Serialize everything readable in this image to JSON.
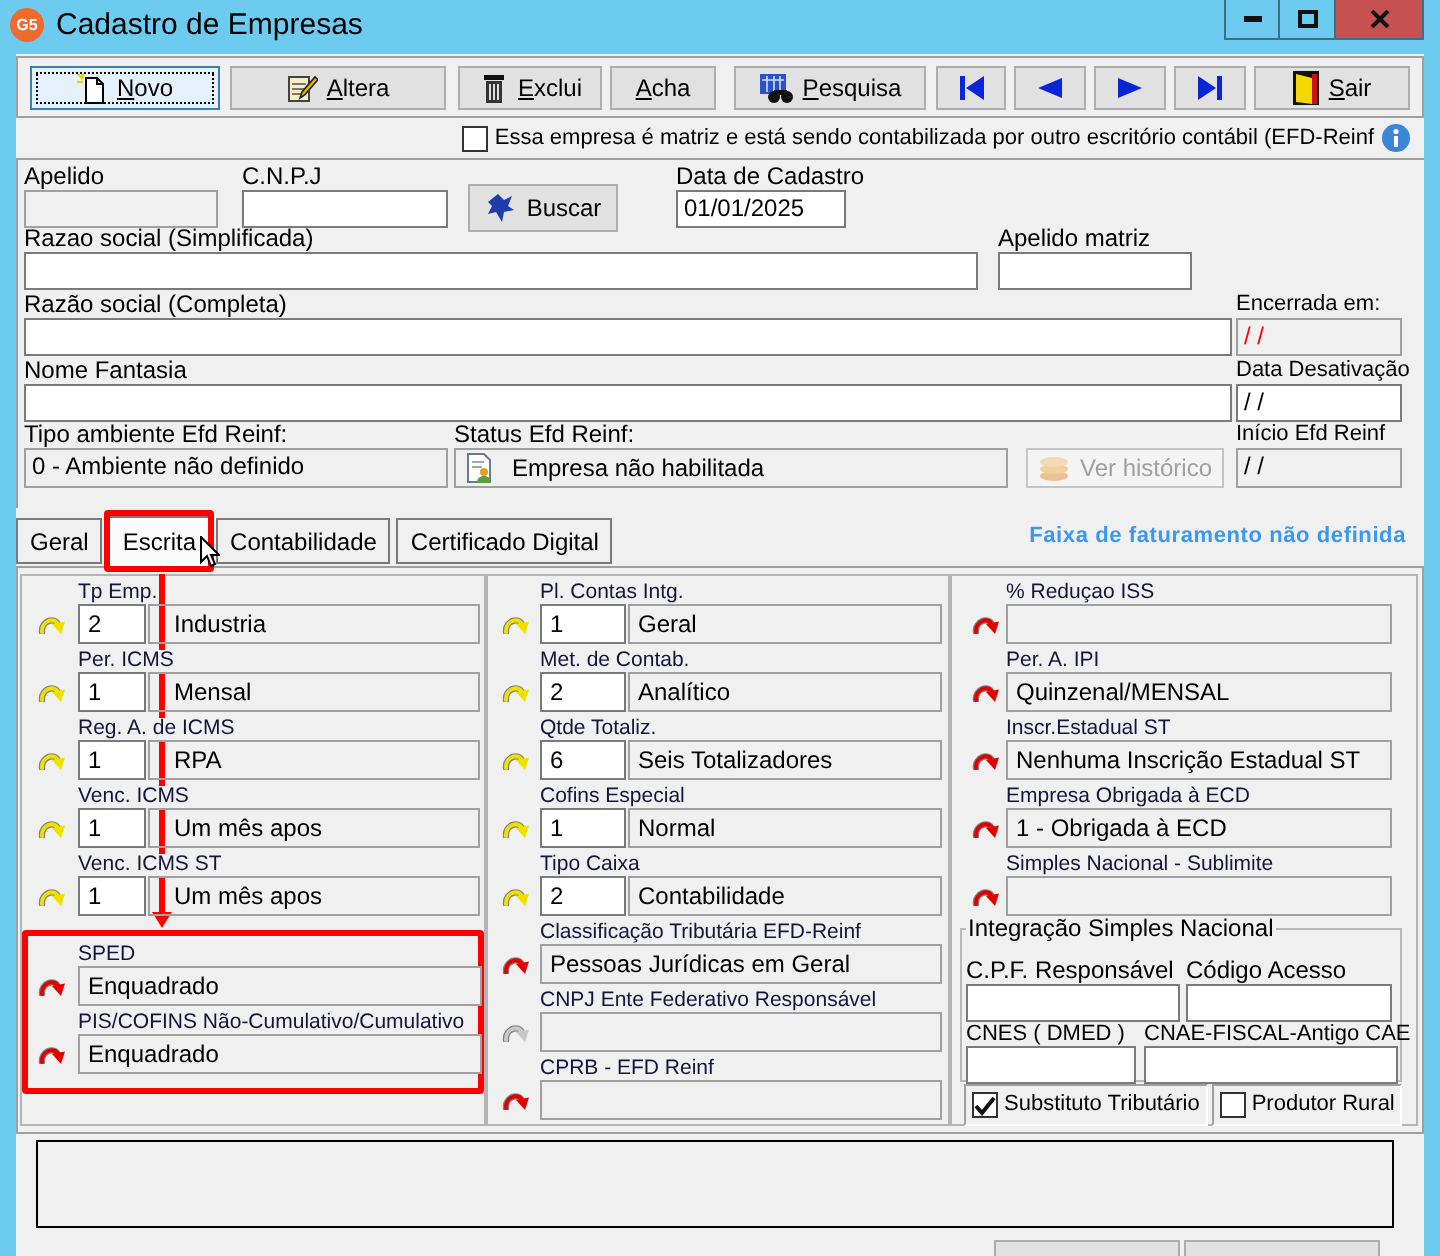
{
  "window": {
    "logo": "G5",
    "title": "Cadastro de Empresas"
  },
  "toolbar": [
    {
      "kind": "new",
      "label": "Novo",
      "mnemonic": true,
      "focused": true
    },
    {
      "kind": "edit",
      "label": "Altera",
      "mnemonic": true,
      "focused": false
    },
    {
      "kind": "delete",
      "label": "Exclui",
      "mnemonic": true,
      "focused": false
    },
    {
      "kind": "find",
      "label": "Acha",
      "mnemonic": true,
      "focused": false
    },
    {
      "kind": "search",
      "label": "Pesquisa",
      "mnemonic": true,
      "focused": false
    },
    {
      "kind": "first",
      "focused": false
    },
    {
      "kind": "prev",
      "focused": false
    },
    {
      "kind": "next",
      "focused": false
    },
    {
      "kind": "last",
      "focused": false
    },
    {
      "kind": "exit",
      "label": "Sair",
      "mnemonic": true,
      "focused": false
    }
  ],
  "matriz_checkbox": {
    "label": "Essa empresa é matriz e está sendo contabilizada por outro escritório contábil (EFD-Reinf",
    "checked": false
  },
  "form": {
    "apelido": {
      "label": "Apelido",
      "disabled": true
    },
    "cnpj": {
      "label": "C.N.P.J",
      "disabled": false
    },
    "buscar_button": {
      "label": "Buscar"
    },
    "data_cadastro": {
      "label": "Data de Cadastro",
      "value": "01/01/2025",
      "disabled": false
    },
    "razao_simplificada": {
      "label": "Razao social (Simplificada)",
      "disabled": false
    },
    "apelido_matriz": {
      "label": "Apelido matriz",
      "disabled": false
    },
    "razao_completa": {
      "label": "Razão social (Completa)",
      "disabled": false
    },
    "encerrada_em": {
      "label": "Encerrada em:",
      "value": "/ /",
      "disabled": true,
      "warning": true
    },
    "nome_fantasia": {
      "label": "Nome Fantasia",
      "disabled": false
    },
    "data_desativacao": {
      "label": "Data Desativação",
      "value": "/ /",
      "disabled": false
    },
    "tipo_ambiente": {
      "label": "Tipo ambiente Efd Reinf:",
      "value": "0 - Ambiente não definido",
      "disabled": true
    },
    "status_efd": {
      "label": "Status Efd Reinf:",
      "value": "Empresa não habilitada",
      "disabled": true
    },
    "ver_historico": {
      "label": "Ver histórico",
      "disabled": true
    },
    "inicio_efd": {
      "label": "Início Efd Reinf",
      "value": "/ /",
      "disabled": true
    }
  },
  "tabs": [
    {
      "label": "Geral",
      "selected": false,
      "highlighted": false
    },
    {
      "label": "Escrita",
      "selected": true,
      "highlighted": true
    },
    {
      "label": "Contabilidade",
      "selected": false,
      "highlighted": false
    },
    {
      "label": "Certificado Digital",
      "selected": false,
      "highlighted": false
    }
  ],
  "notice": "Faixa de faturamento não definida",
  "columns": [
    {
      "fields": [
        {
          "label": "Tp Emp.",
          "code": "2",
          "value": "Industria",
          "color": "#f0e000",
          "highlighted": false
        },
        {
          "label": "Per. ICMS",
          "code": "1",
          "value": "Mensal",
          "color": "#f0e000",
          "highlighted": false
        },
        {
          "label": "Reg. A. de ICMS",
          "code": "1",
          "value": "RPA",
          "color": "#f0e000",
          "highlighted": false
        },
        {
          "label": "Venc. ICMS",
          "code": "1",
          "value": "Um mês apos",
          "color": "#f0e000",
          "highlighted": false
        },
        {
          "label": "Venc. ICMS ST",
          "code": "1",
          "value": "Um mês apos",
          "color": "#f0e000",
          "highlighted": false
        },
        {
          "label": "SPED",
          "value": "Enquadrado",
          "color": "#e00000",
          "highlighted": true
        },
        {
          "label": "PIS/COFINS Não-Cumulativo/Cumulativo",
          "value": "Enquadrado",
          "color": "#e00000",
          "highlighted": true
        }
      ]
    },
    {
      "fields": [
        {
          "label": "Pl. Contas Intg.",
          "code": "1",
          "value": "Geral",
          "color": "#f0e000"
        },
        {
          "label": "Met. de Contab.",
          "code": "2",
          "value": "Analítico",
          "color": "#f0e000"
        },
        {
          "label": "Qtde Totaliz.",
          "code": "6",
          "value": "Seis Totalizadores",
          "color": "#f0e000"
        },
        {
          "label": "Cofins Especial",
          "code": "1",
          "value": "Normal",
          "color": "#f0e000"
        },
        {
          "label": "Tipo Caixa",
          "code": "2",
          "value": "Contabilidade",
          "color": "#f0e000"
        },
        {
          "label": "Classificação Tributária EFD-Reinf",
          "value": "Pessoas Jurídicas em Geral",
          "color": "#e00000"
        },
        {
          "label": "CNPJ Ente Federativo Responsável",
          "color": "#c8c8c8"
        },
        {
          "label": "CPRB - EFD Reinf",
          "color": "#e00000"
        }
      ]
    },
    {
      "fields": [
        {
          "label": "% Reduçao ISS",
          "color": "#e00000"
        },
        {
          "label": "Per. A. IPI",
          "value": "Quinzenal/MENSAL",
          "color": "#e00000"
        },
        {
          "label": "Inscr.Estadual ST",
          "value": "Nenhuma Inscrição Estadual ST",
          "color": "#e00000"
        },
        {
          "label": "Empresa Obrigada à ECD",
          "value": "1 - Obrigada à ECD",
          "color": "#e00000"
        },
        {
          "label": "Simples Nacional - Sublimite",
          "color": "#e00000"
        }
      ]
    }
  ],
  "simples_nacional": {
    "title": "Integração Simples Nacional",
    "fields": [
      {
        "label": "C.P.F. Responsável"
      },
      {
        "label": "Código Acesso"
      },
      {
        "label": "CNES ( DMED )"
      },
      {
        "label": "CNAE-FISCAL-Antigo CAE"
      }
    ]
  },
  "checkboxes": [
    {
      "label": "Substituto Tributário",
      "checked": true
    },
    {
      "label": "Produtor Rural",
      "checked": false
    }
  ]
}
